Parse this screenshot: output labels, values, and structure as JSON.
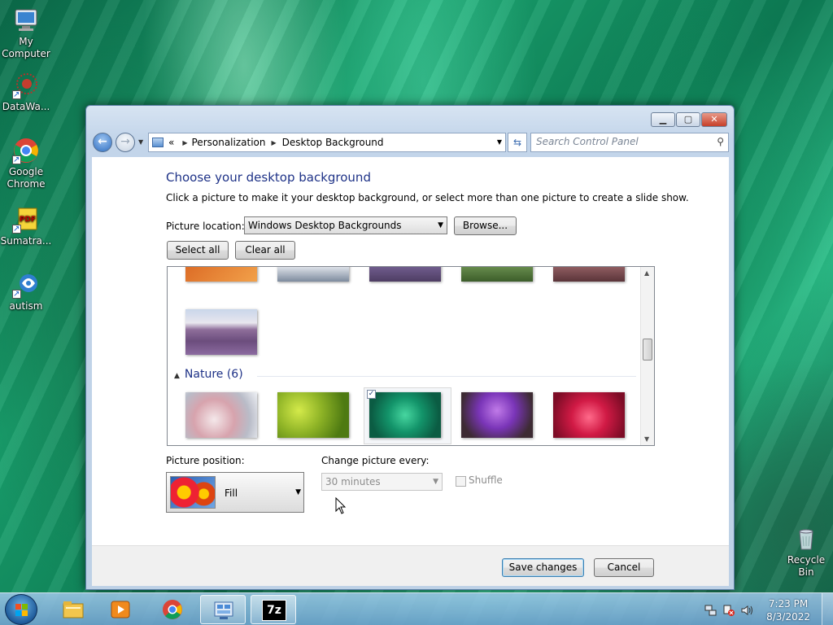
{
  "desktop": {
    "icons": [
      {
        "label": "My\nComputer",
        "line1": "My",
        "line2": "Computer"
      },
      {
        "line1": "DataWa..."
      },
      {
        "line1": "Google",
        "line2": "Chrome"
      },
      {
        "line1": "Sumatra..."
      },
      {
        "line1": "autism"
      },
      {
        "line1": "Recycle Bin"
      }
    ]
  },
  "window": {
    "address": {
      "chevrons": "«",
      "crumb1": "Personalization",
      "crumb2": "Desktop Background"
    },
    "search_placeholder": "Search Control Panel",
    "heading": "Choose your desktop background",
    "description": "Click a picture to make it your desktop background, or select more than one picture to create a slide show.",
    "picture_location_label": "Picture location:",
    "picture_location_value": "Windows Desktop Backgrounds",
    "browse_label": "Browse...",
    "select_all_label": "Select all",
    "clear_all_label": "Clear all",
    "gallery": {
      "group_name": "Nature (6)",
      "selected_check": "✓"
    },
    "picture_position_label": "Picture position:",
    "picture_position_value": "Fill",
    "change_every_label": "Change picture every:",
    "change_every_value": "30 minutes",
    "shuffle_label": "Shuffle",
    "save_label": "Save changes",
    "cancel_label": "Cancel"
  },
  "taskbar": {
    "time": "7:23 PM",
    "date": "8/3/2022",
    "sevenzip_label": "7z"
  },
  "colors": {
    "heading_blue": "#1e3287",
    "taskbar": "#7fb0dc",
    "close_red": "#c6402a"
  }
}
